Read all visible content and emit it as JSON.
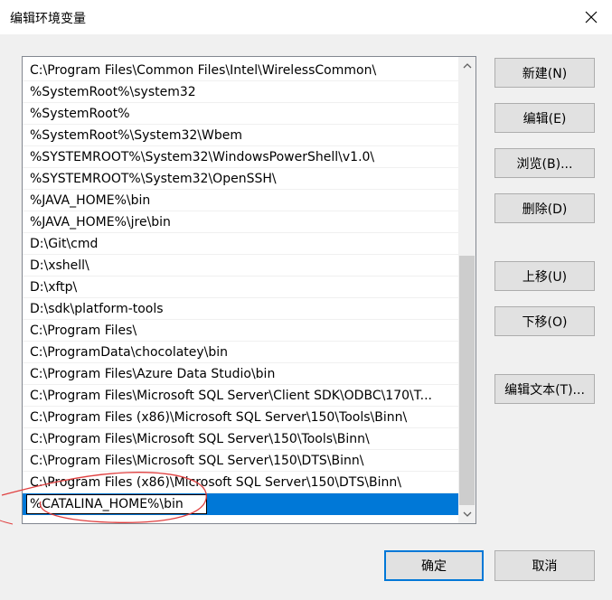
{
  "window": {
    "title": "编辑环境变量"
  },
  "path_list": {
    "items": [
      "C:\\Program Files\\Common Files\\Intel\\WirelessCommon\\",
      "%SystemRoot%\\system32",
      "%SystemRoot%",
      "%SystemRoot%\\System32\\Wbem",
      "%SYSTEMROOT%\\System32\\WindowsPowerShell\\v1.0\\",
      "%SYSTEMROOT%\\System32\\OpenSSH\\",
      "%JAVA_HOME%\\bin",
      "%JAVA_HOME%\\jre\\bin",
      "D:\\Git\\cmd",
      "D:\\xshell\\",
      "D:\\xftp\\",
      "D:\\sdk\\platform-tools",
      "C:\\Program Files\\",
      "C:\\ProgramData\\chocolatey\\bin",
      "C:\\Program Files\\Azure Data Studio\\bin",
      "C:\\Program Files\\Microsoft SQL Server\\Client SDK\\ODBC\\170\\T...",
      "C:\\Program Files (x86)\\Microsoft SQL Server\\150\\Tools\\Binn\\",
      "C:\\Program Files\\Microsoft SQL Server\\150\\Tools\\Binn\\",
      "C:\\Program Files\\Microsoft SQL Server\\150\\DTS\\Binn\\",
      "C:\\Program Files (x86)\\Microsoft SQL Server\\150\\DTS\\Binn\\"
    ],
    "editing_value": "%CATALINA_HOME%\\bin"
  },
  "buttons": {
    "new": "新建(N)",
    "edit": "编辑(E)",
    "browse": "浏览(B)...",
    "delete": "删除(D)",
    "move_up": "上移(U)",
    "move_down": "下移(O)",
    "edit_text": "编辑文本(T)...",
    "ok": "确定",
    "cancel": "取消"
  },
  "colors": {
    "selection": "#0078d7",
    "annotation": "#e04040"
  }
}
